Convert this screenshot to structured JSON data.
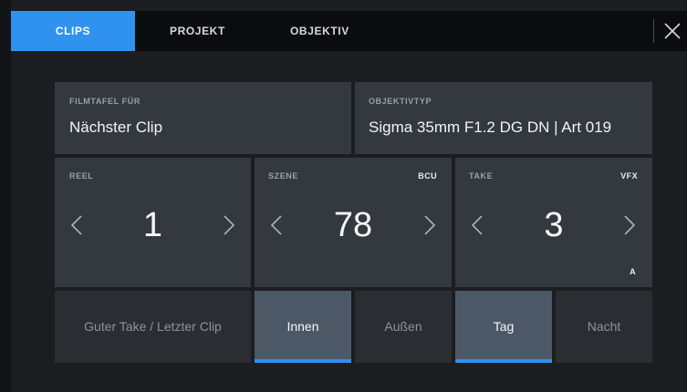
{
  "tabs": [
    {
      "label": "CLIPS",
      "active": true
    },
    {
      "label": "PROJEKT",
      "active": false
    },
    {
      "label": "OBJEKTIV",
      "active": false
    }
  ],
  "close_icon": "close-icon",
  "filmtafel": {
    "label": "FILMTAFEL FÜR",
    "value": "Nächster Clip"
  },
  "objektivtyp": {
    "label": "OBJEKTIVTYP",
    "value": "Sigma 35mm F1.2 DG DN | Art 019"
  },
  "reel": {
    "label": "REEL",
    "value": "1"
  },
  "szene": {
    "label": "SZENE",
    "value": "78",
    "badge": "BCU"
  },
  "take": {
    "label": "TAKE",
    "value": "3",
    "badge": "VFX",
    "sub_badge": "A"
  },
  "buttons": {
    "good_take": "Guter Take / Letzter Clip",
    "innen": "Innen",
    "aussen": "Außen",
    "tag": "Tag",
    "nacht": "Nacht"
  },
  "colors": {
    "accent": "#2f92ee",
    "selected_button": "#4d5866"
  }
}
